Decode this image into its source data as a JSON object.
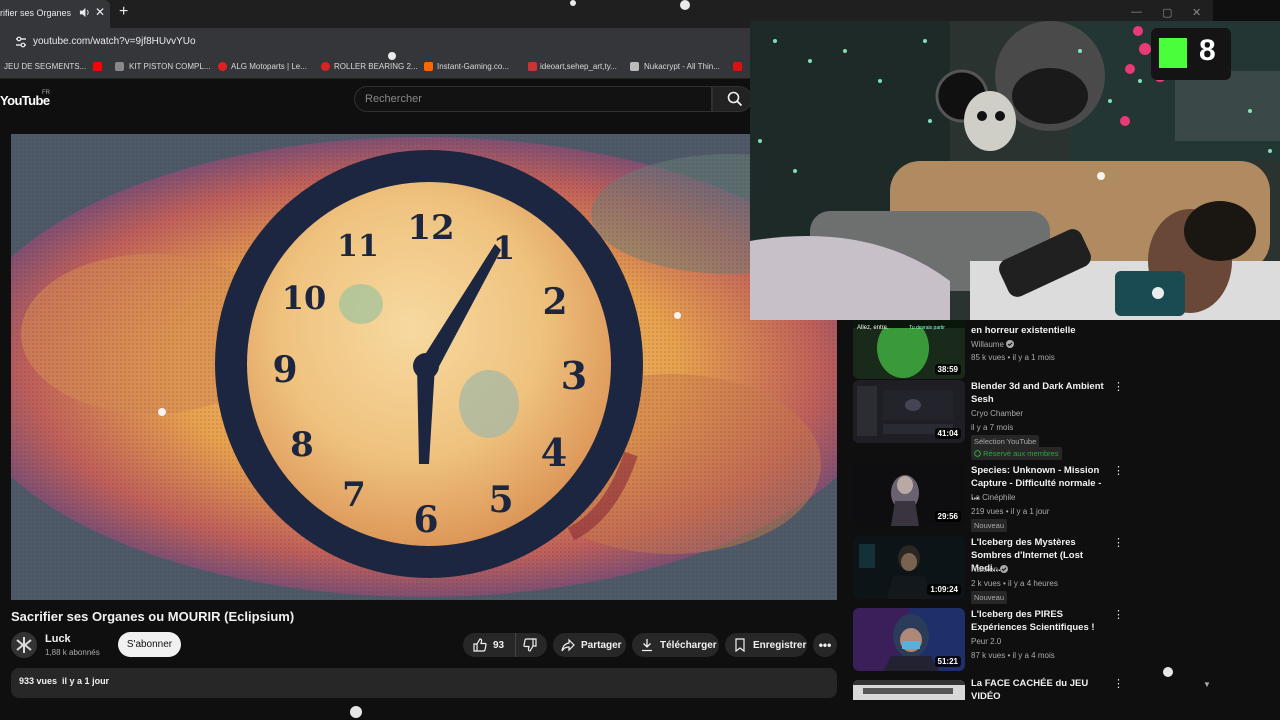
{
  "browser": {
    "tab_title": "rifier ses Organes ou",
    "url": "youtube.com/watch?v=9jf8HUvvYUo",
    "bookmarks": [
      "JEU DE SEGMENTS...",
      "KIT PISTON COMPL...",
      "ALG Motoparts | Le...",
      "ROLLER BEARING 2...",
      "Instant-Gaming.co...",
      "ideoart,sehep_art,ty...",
      "Nukacrypt - All Thin..."
    ]
  },
  "youtube": {
    "logo": "YouTube",
    "region": "FR",
    "search_placeholder": "Rechercher"
  },
  "clock": {
    "numerals": [
      "12",
      "1",
      "2",
      "3",
      "4",
      "5",
      "6",
      "7",
      "8",
      "9",
      "10",
      "11"
    ]
  },
  "video": {
    "title": "Sacrifier ses Organes ou MOURIR (Eclipsium)",
    "channel": "Luck",
    "subscribers": "1,88 k abonnés",
    "subscribe_label": "S'abonner",
    "likes": "93",
    "share_label": "Partager",
    "download_label": "Télécharger",
    "save_label": "Enregistrer",
    "views": "933 vues",
    "date": "il y a 1 jour"
  },
  "sidebar": [
    {
      "title1": "en horreur existentielle",
      "title2": "",
      "channel": "Willaume",
      "verified": true,
      "meta": "85 k vues • il y a 1 mois",
      "duration": "38:59",
      "thumb_text": "Allez, entre.",
      "thumb_text2": "Tu devrais partir"
    },
    {
      "title1": "Blender 3d and Dark Ambient",
      "title2": "Sesh",
      "channel": "Cryo Chamber",
      "meta": "il y a 7 mois",
      "duration": "41:04",
      "badge1": "Sélection YouTube",
      "badge2": "Réservé aux membres"
    },
    {
      "title1": "Species: Unknown - Mission",
      "title2": "Capture - Difficulté normale - ...",
      "channel": "La Cinéphile",
      "meta": "219 vues • il y a 1 jour",
      "duration": "29:56",
      "badge1": "Nouveau"
    },
    {
      "title1": "L'Iceberg des Mystères",
      "title2": "Sombres d'Internet (Lost Medi...",
      "channel": "Hakken",
      "verified": true,
      "meta": "2 k vues • il y a 4 heures",
      "duration": "1:09:24",
      "badge1": "Nouveau"
    },
    {
      "title1": "L'Iceberg des PIRES",
      "title2": "Expériences Scientifiques !",
      "channel": "Peur 2.0",
      "meta": "87 k vues • il y a 4 mois",
      "duration": "51:21"
    },
    {
      "title1": "La FACE CACHÉE du JEU VIDÉO",
      "title2": ""
    }
  ],
  "overlay": {
    "logo_text": "8"
  },
  "colors": {
    "accent": "#ff0000",
    "background": "#0f0f0f",
    "pill": "#272727",
    "verified_green": "#2ba640"
  }
}
